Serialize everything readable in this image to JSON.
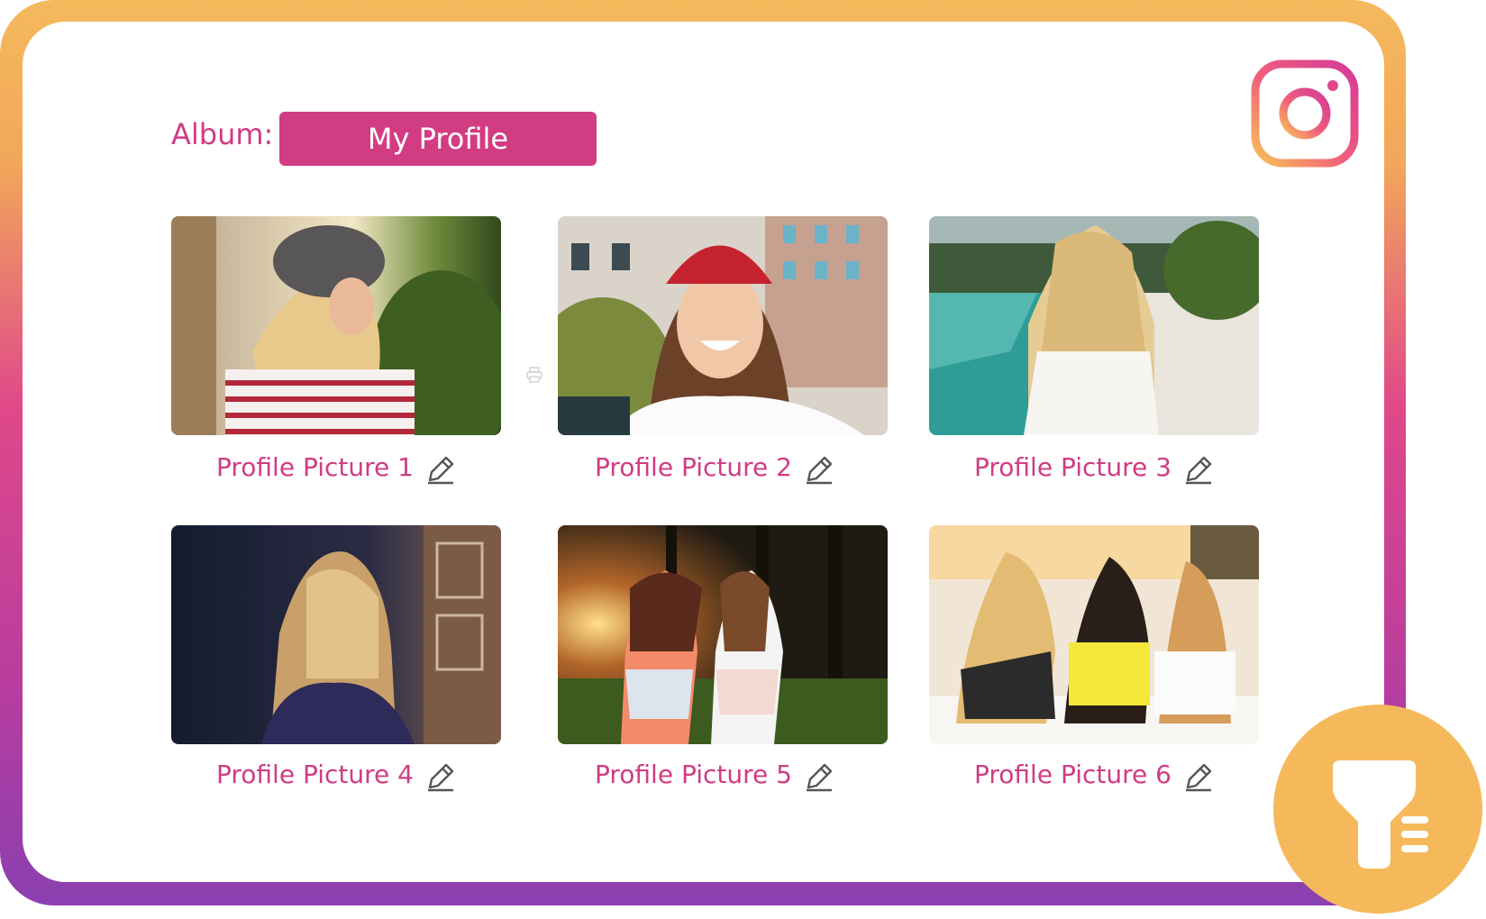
{
  "album": {
    "label": "Album:",
    "selected": "My Profile"
  },
  "colors": {
    "accent": "#d23c82",
    "frame_top": "#f5b95c",
    "frame_bottom": "#8a3fb0",
    "badge": "#f5b95c"
  },
  "gallery": {
    "items": [
      {
        "caption": "Profile Picture 1"
      },
      {
        "caption": "Profile Picture 2"
      },
      {
        "caption": "Profile Picture 3"
      },
      {
        "caption": "Profile Picture 4"
      },
      {
        "caption": "Profile Picture 5"
      },
      {
        "caption": "Profile Picture 6"
      }
    ]
  },
  "icons": {
    "brand": "instagram-icon",
    "edit": "pencil-icon",
    "filter": "funnel-list-icon",
    "print": "printer-icon"
  }
}
